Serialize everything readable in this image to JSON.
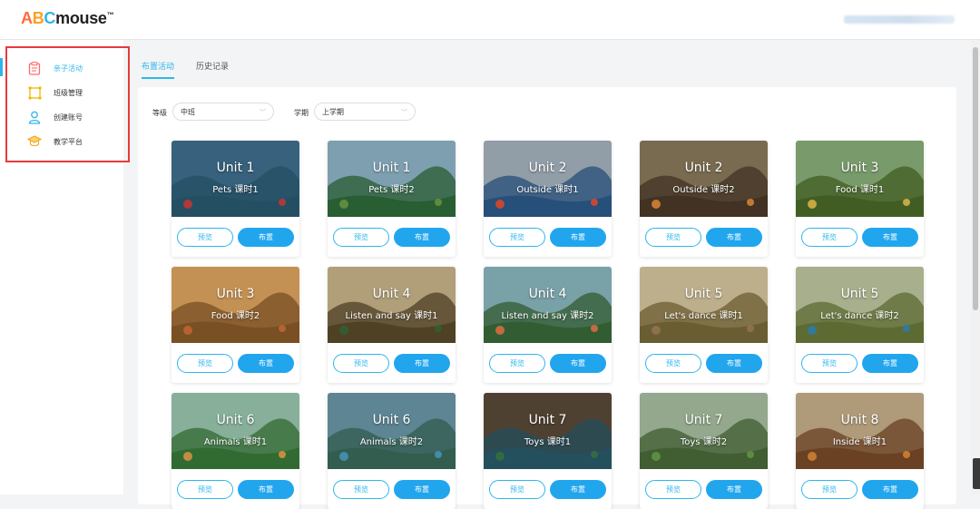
{
  "logo": {
    "a": "A",
    "b": "B",
    "c": "C",
    "rest": "mouse",
    "tm": "™"
  },
  "sidebar": {
    "items": [
      {
        "label": "亲子活动",
        "icon": "clipboard-icon",
        "color": "#ff6b6b"
      },
      {
        "label": "班级管理",
        "icon": "class-frame-icon",
        "color": "#f5b700"
      },
      {
        "label": "创建账号",
        "icon": "user-icon",
        "color": "#2eb6ec"
      },
      {
        "label": "教学平台",
        "icon": "graduation-cap-icon",
        "color": "#f5a623"
      }
    ]
  },
  "tabs": [
    {
      "label": "布置活动"
    },
    {
      "label": "历史记录"
    }
  ],
  "filters": {
    "level_label": "等级",
    "level_value": "中班",
    "term_label": "学期",
    "term_value": "上学期"
  },
  "buttons": {
    "preview": "预览",
    "assign": "布置"
  },
  "cards": [
    {
      "unit": "Unit 1",
      "lesson": "Pets 课时1",
      "sky": "#3f6f8e",
      "ground": "#2a5a70",
      "accent": "#c94040"
    },
    {
      "unit": "Unit 1",
      "lesson": "Pets 课时2",
      "sky": "#8fb6c9",
      "ground": "#2f6a3a",
      "accent": "#6aa04a"
    },
    {
      "unit": "Unit 2",
      "lesson": "Outside 课时1",
      "sky": "#a6b3bf",
      "ground": "#2c5a8a",
      "accent": "#e0523a"
    },
    {
      "unit": "Unit 2",
      "lesson": "Outside 课时2",
      "sky": "#8a7a5c",
      "ground": "#4a3a2a",
      "accent": "#e08a3a"
    },
    {
      "unit": "Unit 3",
      "lesson": "Food 课时1",
      "sky": "#8ab07a",
      "ground": "#4a6a2a",
      "accent": "#e0c04a"
    },
    {
      "unit": "Unit 3",
      "lesson": "Food 课时2",
      "sky": "#e0a660",
      "ground": "#8a5a2a",
      "accent": "#d0703a"
    },
    {
      "unit": "Unit 4",
      "lesson": "Listen and say 课时1",
      "sky": "#c9b58a",
      "ground": "#5a4a2a",
      "accent": "#3a6a3a"
    },
    {
      "unit": "Unit 4",
      "lesson": "Listen and say 课时2",
      "sky": "#8ab8c0",
      "ground": "#3a6a3a",
      "accent": "#e07a4a"
    },
    {
      "unit": "Unit 5",
      "lesson": "Let's dance 课时1",
      "sky": "#d9c8a0",
      "ground": "#7a6a3a",
      "accent": "#a0805a"
    },
    {
      "unit": "Unit 5",
      "lesson": "Let's dance 课时2",
      "sky": "#c0c8a0",
      "ground": "#6a7a3a",
      "accent": "#3a8ab0"
    },
    {
      "unit": "Unit 6",
      "lesson": "Animals 课时1",
      "sky": "#9ac8b0",
      "ground": "#3a7a3a",
      "accent": "#e0a04a"
    },
    {
      "unit": "Unit 6",
      "lesson": "Animals 课时2",
      "sky": "#6a98a8",
      "ground": "#3a6a5a",
      "accent": "#4aa0c0"
    },
    {
      "unit": "Unit 7",
      "lesson": "Toys 课时1",
      "sky": "#5a4a3a",
      "ground": "#2a5a6a",
      "accent": "#3a7a4a"
    },
    {
      "unit": "Unit 7",
      "lesson": "Toys 课时2",
      "sky": "#a8c0a0",
      "ground": "#4a6a3a",
      "accent": "#6aa04a"
    },
    {
      "unit": "Unit 8",
      "lesson": "Inside 课时1",
      "sky": "#c8b08a",
      "ground": "#7a4a2a",
      "accent": "#e08a3a"
    }
  ]
}
